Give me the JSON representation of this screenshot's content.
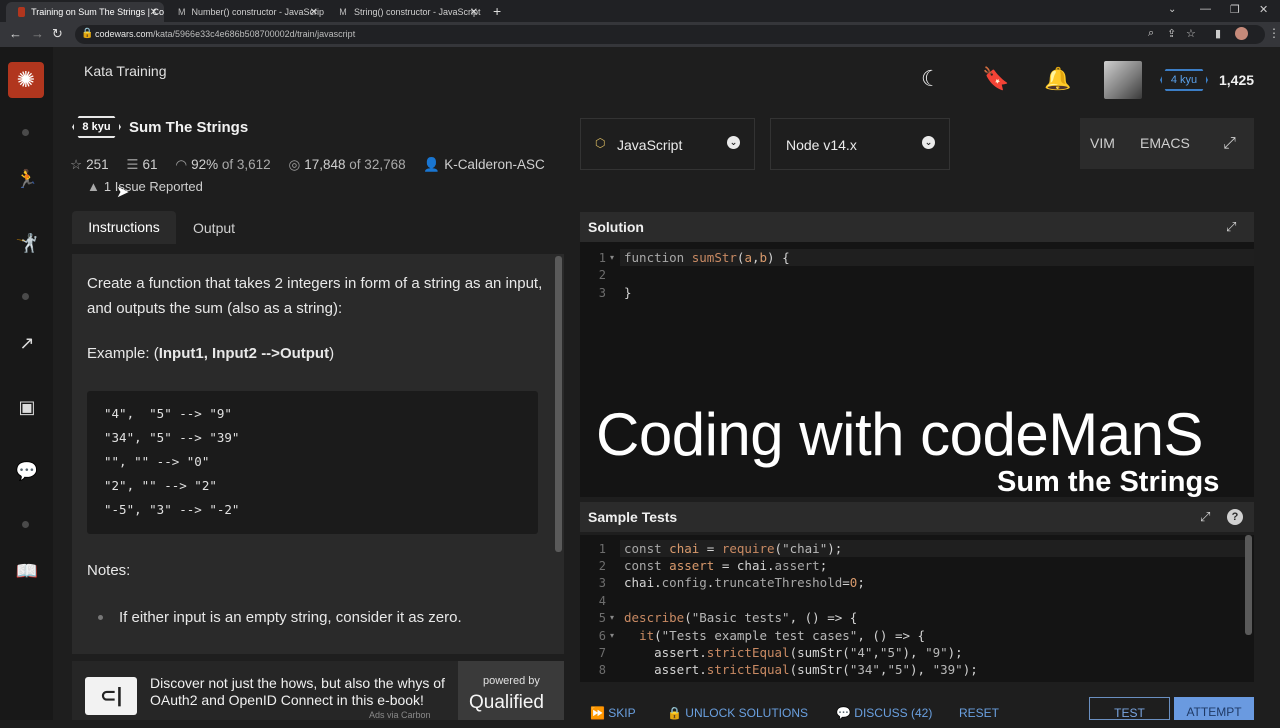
{
  "browser": {
    "tabs": [
      {
        "title": "Training on Sum The Strings | Co",
        "favicon": "codewars-favicon"
      },
      {
        "title": "Number() constructor - JavaScript",
        "favicon": "mdn-favicon"
      },
      {
        "title": "String() constructor - JavaScript",
        "favicon": "mdn-favicon"
      }
    ],
    "url_domain": "codewars.com",
    "url_path": "/kata/5966e33c4e686b508700002d/train/javascript"
  },
  "header": {
    "title": "Kata Training",
    "rank": "4 kyu",
    "honor": "1,425"
  },
  "kata": {
    "rank": "8 kyu",
    "title": "Sum The Strings",
    "stats": {
      "stars": "251",
      "collections": "61",
      "satisfaction": "92%",
      "satisfaction_of": "of 3,612",
      "completed": "17,848",
      "completed_of": "of 32,768",
      "author": "K-Calderon-ASC"
    },
    "issues": "1 Issue Reported"
  },
  "tabs": {
    "instructions": "Instructions",
    "output": "Output"
  },
  "instructions": {
    "para1": "Create a function that takes 2 integers in form of a string as an input, and outputs the sum (also as a string):",
    "example_prefix": "Example: (",
    "example_bold": "Input1, Input2 -->Output",
    "example_suffix": ")",
    "examples": [
      "\"4\",  \"5\" --> \"9\"",
      "\"34\", \"5\" --> \"39\"",
      "\"\", \"\" --> \"0\"",
      "\"2\", \"\" --> \"2\"",
      "\"-5\", \"3\" --> \"-2\""
    ],
    "notes_title": "Notes:",
    "notes": [
      "If either input is an empty string, consider it as zero."
    ]
  },
  "ad": {
    "text": "Discover not just the hows, but also the whys of OAuth2 and OpenID Connect in this e-book!",
    "powered": "powered by",
    "brand": "Qualified",
    "via": "Ads via Carbon"
  },
  "editor": {
    "language": "JavaScript",
    "runtime": "Node v14.x",
    "mode_vim": "VIM",
    "mode_emacs": "EMACS",
    "solution_title": "Solution",
    "tests_title": "Sample Tests"
  },
  "overlay": {
    "line1": "Coding with codeManS",
    "line2": "Sum the Strings"
  },
  "actions": {
    "skip": "SKIP",
    "unlock": "UNLOCK SOLUTIONS",
    "discuss": "DISCUSS (42)",
    "reset": "RESET",
    "test": "TEST",
    "attempt": "ATTEMPT"
  }
}
